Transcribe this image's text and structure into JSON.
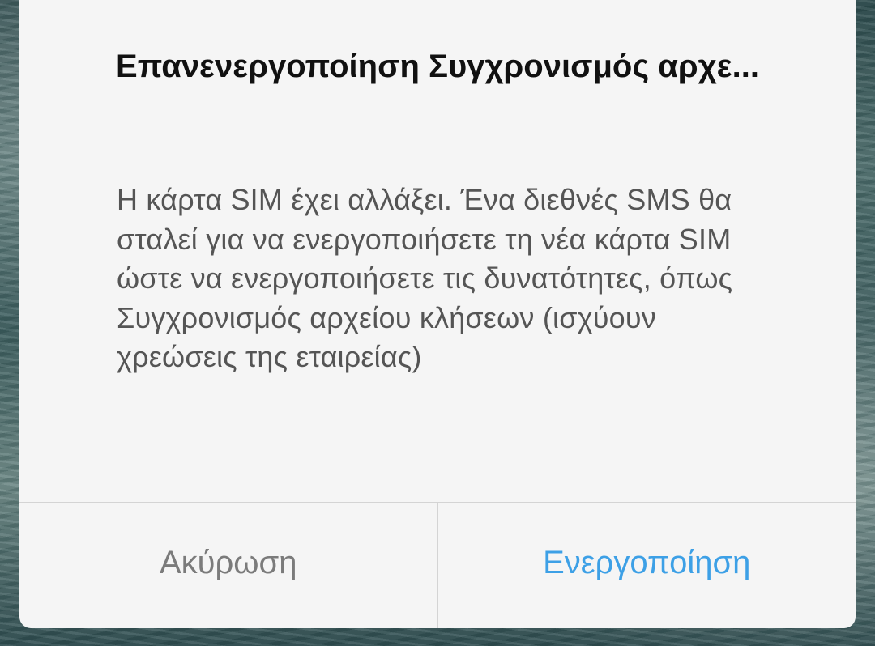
{
  "dialog": {
    "title": "Επανενεργοποίηση Συγχρονισμός αρχε...",
    "message": "Η κάρτα SIM έχει αλλάξει. Ένα διεθνές SMS θα σταλεί για να ενεργοποιήσετε τη νέα κάρτα SIM ώστε να ενεργοποιήσετε τις δυνατότητες, όπως Συγχρονισμός αρχείου κλήσεων (ισχύουν χρεώσεις της εταιρείας)",
    "cancel_label": "Ακύρωση",
    "confirm_label": "Ενεργοποίηση"
  },
  "colors": {
    "dialog_background": "#f5f5f5",
    "title_text": "#111111",
    "message_text": "#555555",
    "cancel_text": "#7b7b7b",
    "confirm_text": "#3da0e6",
    "divider": "#d4d4d4"
  }
}
